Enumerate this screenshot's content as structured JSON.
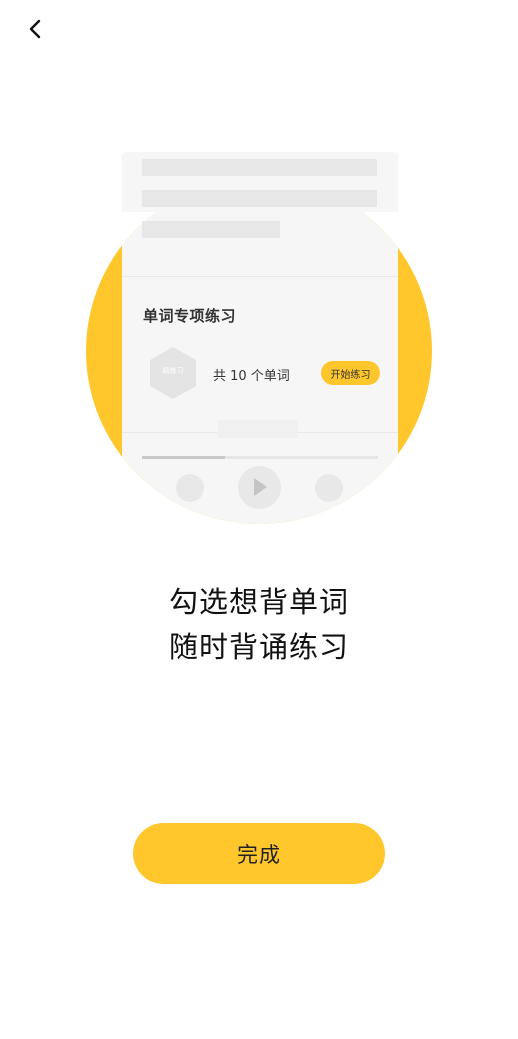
{
  "nav": {
    "back_icon": "chevron-left-icon"
  },
  "illustration": {
    "card_title": "单词专项练习",
    "hex_badge_text": "精练习",
    "word_count": "共 10 个单词",
    "start_button": "开始练习",
    "progress": 0.35,
    "accent_color": "#FFC72C"
  },
  "caption": {
    "line1": "勾选想背单词",
    "line2": "随时背诵练习"
  },
  "done_button": {
    "label": "完成"
  }
}
